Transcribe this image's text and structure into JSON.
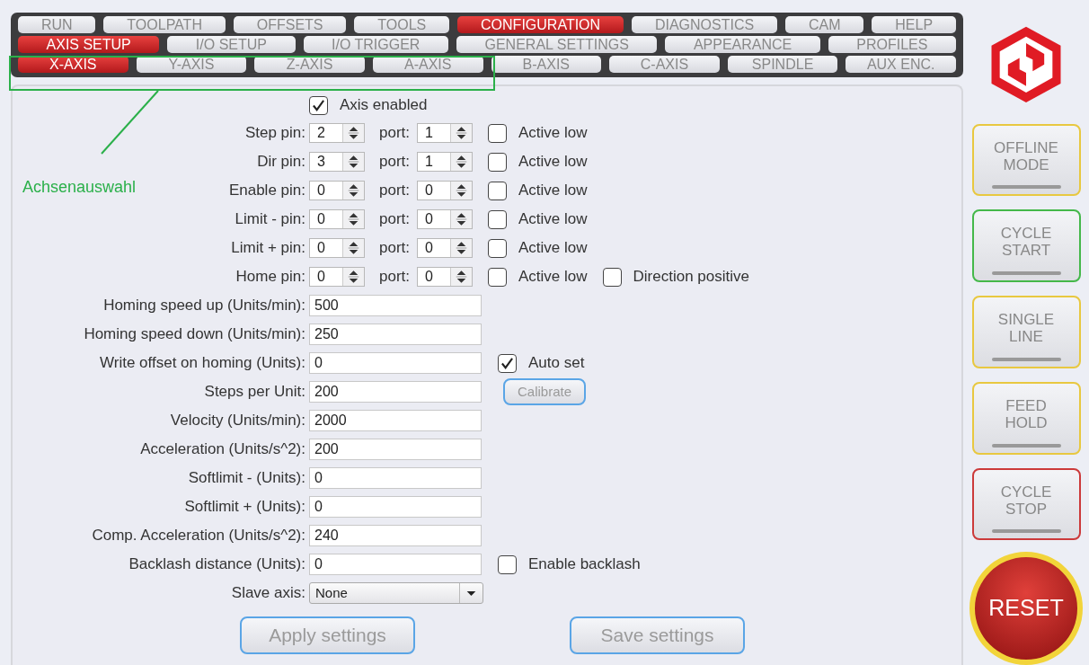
{
  "tabs_main": [
    {
      "label": "RUN",
      "selected": false
    },
    {
      "label": "TOOLPATH",
      "selected": false
    },
    {
      "label": "OFFSETS",
      "selected": false
    },
    {
      "label": "TOOLS",
      "selected": false
    },
    {
      "label": "CONFIGURATION",
      "selected": true
    },
    {
      "label": "DIAGNOSTICS",
      "selected": false
    },
    {
      "label": "CAM",
      "selected": false
    },
    {
      "label": "HELP",
      "selected": false
    }
  ],
  "tabs_sub": [
    {
      "label": "AXIS SETUP",
      "selected": true
    },
    {
      "label": "I/O SETUP",
      "selected": false
    },
    {
      "label": "I/O TRIGGER",
      "selected": false
    },
    {
      "label": "GENERAL SETTINGS",
      "selected": false
    },
    {
      "label": "APPEARANCE",
      "selected": false
    },
    {
      "label": "PROFILES",
      "selected": false
    }
  ],
  "tabs_axis": [
    {
      "label": "X-AXIS",
      "selected": true
    },
    {
      "label": "Y-AXIS",
      "selected": false
    },
    {
      "label": "Z-AXIS",
      "selected": false
    },
    {
      "label": "A-AXIS",
      "selected": false
    },
    {
      "label": "B-AXIS",
      "selected": false
    },
    {
      "label": "C-AXIS",
      "selected": false
    },
    {
      "label": "SPINDLE",
      "selected": false
    },
    {
      "label": "AUX ENC.",
      "selected": false
    }
  ],
  "annotation": {
    "label": "Achsenauswahl"
  },
  "axis_enabled": {
    "label": "Axis enabled",
    "checked": true
  },
  "pins": [
    {
      "label": "Step pin:",
      "pin": "2",
      "port_label": "port:",
      "port": "1",
      "checks": [
        {
          "label": "Active low",
          "checked": false
        }
      ]
    },
    {
      "label": "Dir pin:",
      "pin": "3",
      "port_label": "port:",
      "port": "1",
      "checks": [
        {
          "label": "Active low",
          "checked": false
        }
      ]
    },
    {
      "label": "Enable pin:",
      "pin": "0",
      "port_label": "port:",
      "port": "0",
      "checks": [
        {
          "label": "Active low",
          "checked": false
        }
      ]
    },
    {
      "label": "Limit - pin:",
      "pin": "0",
      "port_label": "port:",
      "port": "0",
      "checks": [
        {
          "label": "Active low",
          "checked": false
        }
      ]
    },
    {
      "label": "Limit + pin:",
      "pin": "0",
      "port_label": "port:",
      "port": "0",
      "checks": [
        {
          "label": "Active low",
          "checked": false
        }
      ]
    },
    {
      "label": "Home pin:",
      "pin": "0",
      "port_label": "port:",
      "port": "0",
      "checks": [
        {
          "label": "Active low",
          "checked": false
        },
        {
          "label": "Direction positive",
          "checked": false
        }
      ]
    }
  ],
  "fields": [
    {
      "label": "Homing speed up (Units/min):",
      "value": "500",
      "kind": "text"
    },
    {
      "label": "Homing speed down (Units/min):",
      "value": "250",
      "kind": "text"
    },
    {
      "label": "Write offset on homing (Units):",
      "value": "0",
      "kind": "text",
      "extra": {
        "kind": "check",
        "label": "Auto set",
        "checked": true
      }
    },
    {
      "label": "Steps per Unit:",
      "value": "200",
      "kind": "text",
      "extra": {
        "kind": "button",
        "label": "Calibrate"
      }
    },
    {
      "label": "Velocity (Units/min):",
      "value": "2000",
      "kind": "text"
    },
    {
      "label": "Acceleration (Units/s^2):",
      "value": "200",
      "kind": "text"
    },
    {
      "label": "Softlimit - (Units):",
      "value": "0",
      "kind": "text"
    },
    {
      "label": "Softlimit + (Units):",
      "value": "0",
      "kind": "text"
    },
    {
      "label": "Comp. Acceleration (Units/s^2):",
      "value": "240",
      "kind": "text"
    },
    {
      "label": "Backlash distance (Units):",
      "value": "0",
      "kind": "text",
      "extra": {
        "kind": "check",
        "label": "Enable backlash",
        "checked": false
      }
    },
    {
      "label": "Slave axis:",
      "value": "None",
      "kind": "select"
    }
  ],
  "actions": [
    "Apply settings",
    "Save settings"
  ],
  "side_buttons": [
    {
      "label": "OFFLINE\nMODE",
      "color": "#e8c840"
    },
    {
      "label": "CYCLE\nSTART",
      "color": "#44b84a"
    },
    {
      "label": "SINGLE\nLINE",
      "color": "#e8c840"
    },
    {
      "label": "FEED\nHOLD",
      "color": "#e8c840"
    },
    {
      "label": "CYCLE\nSTOP",
      "color": "#cc3a3a"
    }
  ],
  "reset": {
    "label": "RESET"
  }
}
